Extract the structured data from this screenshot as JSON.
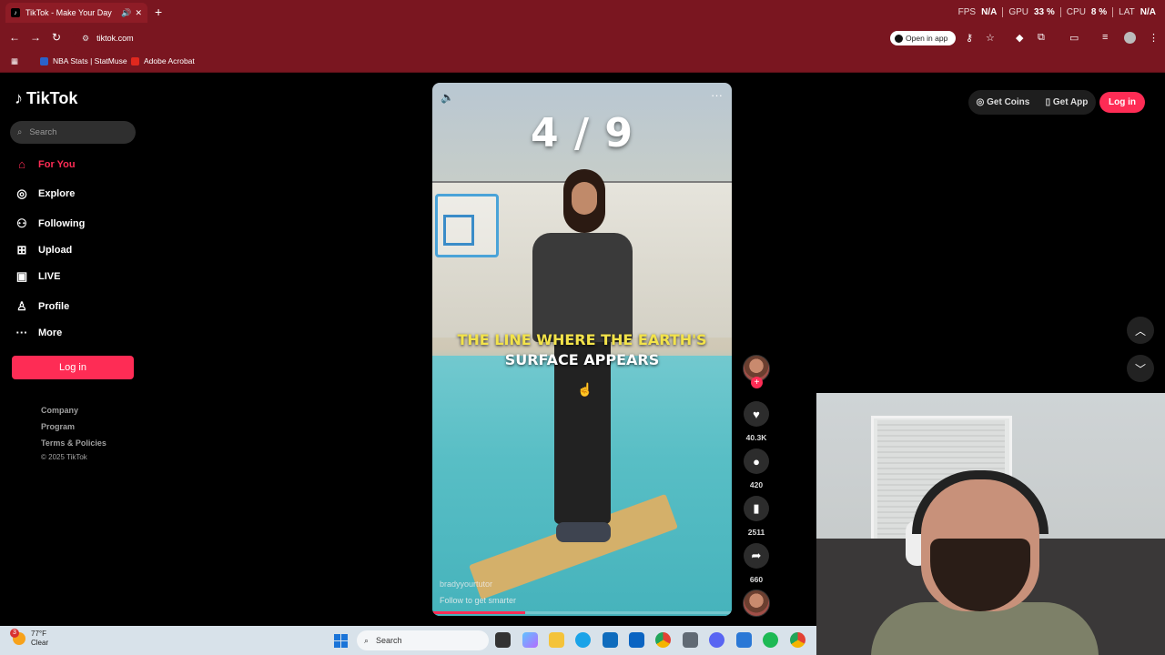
{
  "browser": {
    "tab_title": "TikTok - Make Your Day",
    "url": "tiktok.com",
    "open_in_app": "Open in app",
    "new_tab": "+",
    "perf": {
      "fps_label": "FPS",
      "fps_value": "N/A",
      "gpu_label": "GPU",
      "gpu_value": "33 %",
      "cpu_label": "CPU",
      "cpu_value": "8 %",
      "lat_label": "LAT",
      "lat_value": "N/A"
    },
    "bookmarks": [
      "NBA Stats | StatMuse",
      "Adobe Acrobat"
    ]
  },
  "sidebar": {
    "logo_text": "TikTok",
    "search_placeholder": "Search",
    "nav": [
      {
        "label": "For You",
        "icon": "home-icon"
      },
      {
        "label": "Explore",
        "icon": "compass-icon"
      },
      {
        "label": "Following",
        "icon": "following-icon"
      },
      {
        "label": "Upload",
        "icon": "upload-icon"
      },
      {
        "label": "LIVE",
        "icon": "live-icon"
      },
      {
        "label": "Profile",
        "icon": "profile-icon"
      },
      {
        "label": "More",
        "icon": "more-icon"
      }
    ],
    "login_label": "Log in",
    "footer": [
      "Company",
      "Program",
      "Terms & Policies"
    ],
    "copyright": "© 2025 TikTok"
  },
  "header": {
    "get_coins": "Get Coins",
    "get_app": "Get App",
    "login": "Log in"
  },
  "video": {
    "counter": "4 / 9",
    "caption_line1": "THE LINE WHERE THE EARTH'S",
    "caption_line2": "SURFACE APPEARS",
    "username": "bradyyourtutor",
    "follow_text": "Follow to get smarter",
    "progress": 0.31
  },
  "actions": {
    "likes": "40.3K",
    "comments": "420",
    "saves": "2511",
    "shares": "660"
  },
  "taskbar": {
    "weather_temp": "77°F",
    "weather_desc": "Clear",
    "weather_badge": "3",
    "search_label": "Search"
  },
  "colors": {
    "accent": "#fe2c55",
    "browser_chrome": "#7a1620"
  }
}
